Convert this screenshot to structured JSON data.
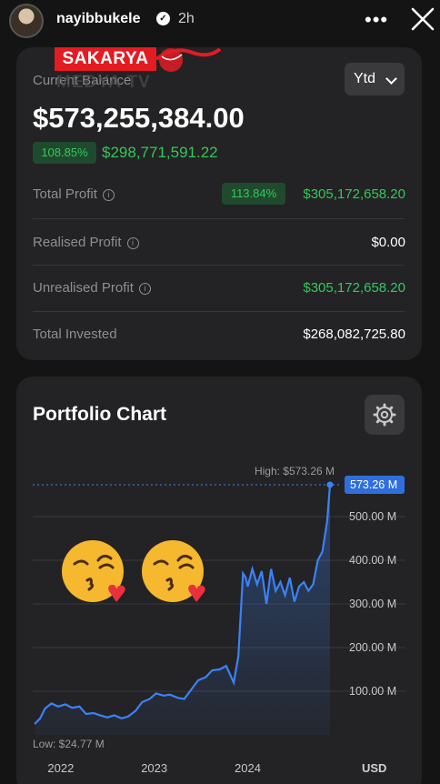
{
  "story": {
    "username": "nayibbukele",
    "time": "2h",
    "more": "•••"
  },
  "watermark": {
    "brand": "SAKARYA",
    "sub": "MEDYA TV"
  },
  "balance": {
    "label": "Current Balance",
    "period": "Ytd",
    "amount": "$573,255,384.00",
    "change_pct": "108.85%",
    "change_amount": "$298,771,591.22"
  },
  "rows": [
    {
      "label": "Total Profit",
      "pct": "113.84%",
      "value": "$305,172,658.20",
      "color": "#34c759"
    },
    {
      "label": "Realised Profit",
      "value": "$0.00",
      "color": "#ffffff"
    },
    {
      "label": "Unrealised Profit",
      "value": "$305,172,658.20",
      "color": "#34c759"
    },
    {
      "label": "Total Invested",
      "value": "$268,082,725.80",
      "color": "#ffffff"
    }
  ],
  "chart_data": {
    "type": "line",
    "title": "Portfolio Chart",
    "x_ticks": [
      "2022",
      "2023",
      "2024"
    ],
    "currency": "USD",
    "y_ticks": [
      "100.00 M",
      "200.00 M",
      "300.00 M",
      "400.00 M",
      "500.00 M"
    ],
    "ylim": [
      0,
      600
    ],
    "high_label": "High: $573.26 M",
    "low_label": "Low: $24.77 M",
    "current_label": "573.26 M",
    "line_color": "#3b82f6",
    "series": [
      {
        "x": [
          2021.72,
          2021.78,
          2021.83,
          2021.9,
          2021.97,
          2022.05,
          2022.12,
          2022.2,
          2022.27,
          2022.35,
          2022.42,
          2022.5,
          2022.57,
          2022.65,
          2022.72,
          2022.8,
          2022.87,
          2022.95,
          2023.02,
          2023.1,
          2023.17,
          2023.25,
          2023.32,
          2023.4,
          2023.47,
          2023.55,
          2023.62,
          2023.7,
          2023.77,
          2023.85,
          2023.9,
          2023.95,
          2023.98,
          2024.0,
          2024.05,
          2024.1,
          2024.15,
          2024.2,
          2024.25,
          2024.3,
          2024.35,
          2024.4,
          2024.45,
          2024.5,
          2024.55,
          2024.6,
          2024.65,
          2024.7,
          2024.75,
          2024.8,
          2024.85,
          2024.88
        ],
        "y": [
          25,
          38,
          60,
          72,
          65,
          70,
          62,
          65,
          48,
          50,
          45,
          40,
          45,
          38,
          42,
          55,
          75,
          82,
          95,
          90,
          92,
          85,
          82,
          105,
          125,
          132,
          148,
          150,
          158,
          120,
          180,
          370,
          360,
          340,
          380,
          345,
          375,
          300,
          380,
          330,
          350,
          320,
          360,
          305,
          340,
          350,
          330,
          345,
          400,
          420,
          490,
          573
        ]
      }
    ]
  }
}
